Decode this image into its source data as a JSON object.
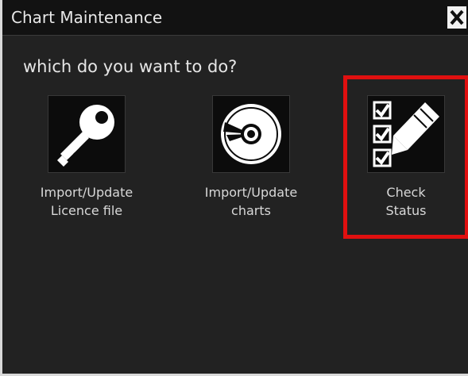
{
  "window": {
    "title": "Chart Maintenance",
    "close_label": "X"
  },
  "prompt": "which do you want to do?",
  "options": [
    {
      "icon": "key-icon",
      "label_line1": "Import/Update",
      "label_line2": "Licence file"
    },
    {
      "icon": "disc-icon",
      "label_line1": "Import/Update",
      "label_line2": "charts"
    },
    {
      "icon": "checklist-pencil-icon",
      "label_line1": "Check",
      "label_line2": "Status"
    }
  ],
  "highlight": {
    "target": "check-status",
    "color": "#e01010"
  },
  "colors": {
    "background": "#222222",
    "titlebar": "#121212",
    "text": "#e6e6e6"
  }
}
